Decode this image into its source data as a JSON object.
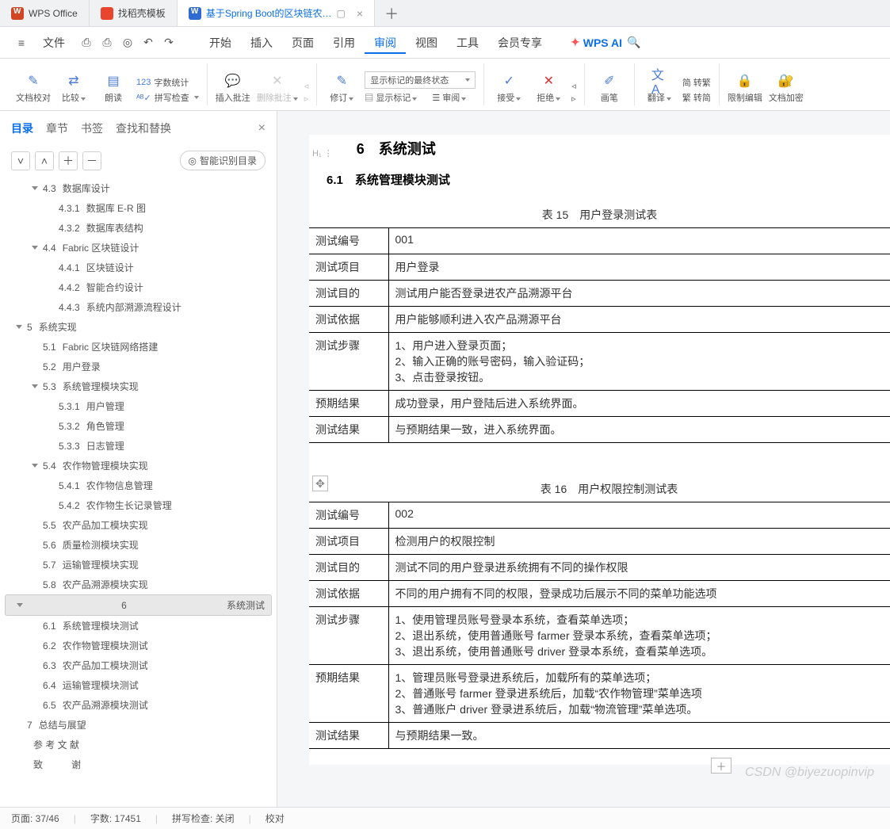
{
  "tabs": [
    {
      "label": "WPS Office",
      "active": false
    },
    {
      "label": "找稻壳模板",
      "active": false
    },
    {
      "label": "基于Spring Boot的区块链农…",
      "active": true
    }
  ],
  "menu": {
    "file": "文件",
    "items": [
      "开始",
      "插入",
      "页面",
      "引用",
      "审阅",
      "视图",
      "工具",
      "会员专享"
    ],
    "active": "审阅",
    "ai": "WPS AI"
  },
  "ribbon": {
    "g1": {
      "a": "文档校对",
      "b": "比较",
      "c": "朗读",
      "d": "拼写检查",
      "e": "字数统计"
    },
    "g2": {
      "a": "插入批注",
      "b": "删除批注"
    },
    "g3": {
      "a": "修订",
      "sel": "显示标记的最终状态",
      "b": "显示标记",
      "c": "审阅"
    },
    "g4": {
      "a": "接受",
      "b": "拒绝"
    },
    "g5": {
      "a": "画笔"
    },
    "g6": {
      "a": "翻译",
      "b": "简 转繁",
      "c": "繁 转简"
    },
    "g7": {
      "a": "限制编辑",
      "b": "文档加密"
    }
  },
  "side": {
    "tabs": [
      "目录",
      "章节",
      "书签",
      "查找和替换"
    ],
    "active": "目录",
    "smart": "智能识别目录",
    "toc": [
      {
        "lv": 1,
        "num": "4.3",
        "t": "数据库设计",
        "exp": true
      },
      {
        "lv": 2,
        "num": "4.3.1",
        "t": "数据库 E-R 图"
      },
      {
        "lv": 2,
        "num": "4.3.2",
        "t": "数据库表结构"
      },
      {
        "lv": 1,
        "num": "4.4",
        "t": "Fabric 区块链设计",
        "exp": true
      },
      {
        "lv": 2,
        "num": "4.4.1",
        "t": "区块链设计"
      },
      {
        "lv": 2,
        "num": "4.4.2",
        "t": "智能合约设计"
      },
      {
        "lv": 2,
        "num": "4.4.3",
        "t": "系统内部溯源流程设计"
      },
      {
        "lv": 0,
        "num": "5",
        "t": "系统实现",
        "exp": true
      },
      {
        "lv": 1,
        "num": "5.1",
        "t": "Fabric 区块链网络搭建"
      },
      {
        "lv": 1,
        "num": "5.2",
        "t": "用户登录"
      },
      {
        "lv": 1,
        "num": "5.3",
        "t": "系统管理模块实现",
        "exp": true
      },
      {
        "lv": 2,
        "num": "5.3.1",
        "t": "用户管理"
      },
      {
        "lv": 2,
        "num": "5.3.2",
        "t": "角色管理"
      },
      {
        "lv": 2,
        "num": "5.3.3",
        "t": "日志管理"
      },
      {
        "lv": 1,
        "num": "5.4",
        "t": "农作物管理模块实现",
        "exp": true
      },
      {
        "lv": 2,
        "num": "5.4.1",
        "t": "农作物信息管理"
      },
      {
        "lv": 2,
        "num": "5.4.2",
        "t": "农作物生长记录管理"
      },
      {
        "lv": 1,
        "num": "5.5",
        "t": "农产品加工模块实现"
      },
      {
        "lv": 1,
        "num": "5.6",
        "t": "质量检测模块实现"
      },
      {
        "lv": 1,
        "num": "5.7",
        "t": "运输管理模块实现"
      },
      {
        "lv": 1,
        "num": "5.8",
        "t": "农产品溯源模块实现"
      },
      {
        "lv": 0,
        "num": "6",
        "t": "系统测试",
        "exp": true,
        "sel": true
      },
      {
        "lv": 1,
        "num": "6.1",
        "t": "系统管理模块测试"
      },
      {
        "lv": 1,
        "num": "6.2",
        "t": "农作物管理模块测试"
      },
      {
        "lv": 1,
        "num": "6.3",
        "t": "农产品加工模块测试"
      },
      {
        "lv": 1,
        "num": "6.4",
        "t": "运输管理模块测试"
      },
      {
        "lv": 1,
        "num": "6.5",
        "t": "农产品溯源模块测试"
      },
      {
        "lv": 0,
        "num": "7",
        "t": "总结与展望"
      },
      {
        "lv": 0,
        "num": "",
        "t": "参 考 文 献"
      },
      {
        "lv": 0,
        "num": "",
        "t": "致　　　谢"
      }
    ]
  },
  "doc": {
    "h1": "6　系统测试",
    "h2": "6.1　系统管理模块测试",
    "t1cap": "表 15　用户登录测试表",
    "t1": [
      [
        "测试编号",
        "001"
      ],
      [
        "测试项目",
        "用户登录"
      ],
      [
        "测试目的",
        "测试用户能否登录进农产品溯源平台"
      ],
      [
        "测试依据",
        "用户能够顺利进入农产品溯源平台"
      ],
      [
        "测试步骤",
        "1、用户进入登录页面；<br>2、输入正确的账号密码，输入验证码；<br>3、点击登录按钮。"
      ],
      [
        "预期结果",
        "成功登录，用户登陆后进入系统界面。"
      ],
      [
        "测试结果",
        "与预期结果一致，进入系统界面。"
      ]
    ],
    "t2cap": "表 16　用户权限控制测试表",
    "t2": [
      [
        "测试编号",
        "002"
      ],
      [
        "测试项目",
        "检测用户的权限控制"
      ],
      [
        "测试目的",
        "测试不同的用户登录进系统拥有不同的操作权限"
      ],
      [
        "测试依据",
        "不同的用户拥有不同的权限，登录成功后展示不同的菜单功能选项"
      ],
      [
        "测试步骤",
        "1、使用管理员账号登录本系统，查看菜单选项；<br>2、退出系统，使用普通账号 farmer 登录本系统，查看菜单选项；<br>3、退出系统，使用普通账号 driver 登录本系统，查看菜单选项。"
      ],
      [
        "预期结果",
        "1、管理员账号登录进系统后，加载所有的菜单选项；<br>2、普通账号 farmer 登录进系统后，加载“农作物管理”菜单选项<br>3、普通账户 driver 登录进系统后，加载“物流管理”菜单选项。"
      ],
      [
        "测试结果",
        "与预期结果一致。"
      ]
    ]
  },
  "status": {
    "page": "页面: 37/46",
    "words": "字数: 17451",
    "spell": "拼写检查: 关闭",
    "proof": "校对"
  },
  "watermark": "CSDN @biyezuopinvip"
}
